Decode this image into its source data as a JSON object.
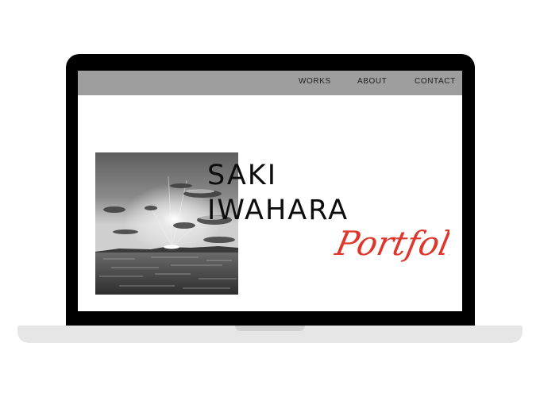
{
  "nav": {
    "items": [
      {
        "label": "WORKS"
      },
      {
        "label": "ABOUT"
      },
      {
        "label": "CONTACT"
      }
    ]
  },
  "hero": {
    "first_name": "SAKI",
    "last_name": "IWAHARA",
    "script_text": "Portfolio"
  },
  "colors": {
    "frame": "#000000",
    "nav_background": "#9e9e9e",
    "script_accent": "#e0352b",
    "base": "#e6e6e6"
  }
}
